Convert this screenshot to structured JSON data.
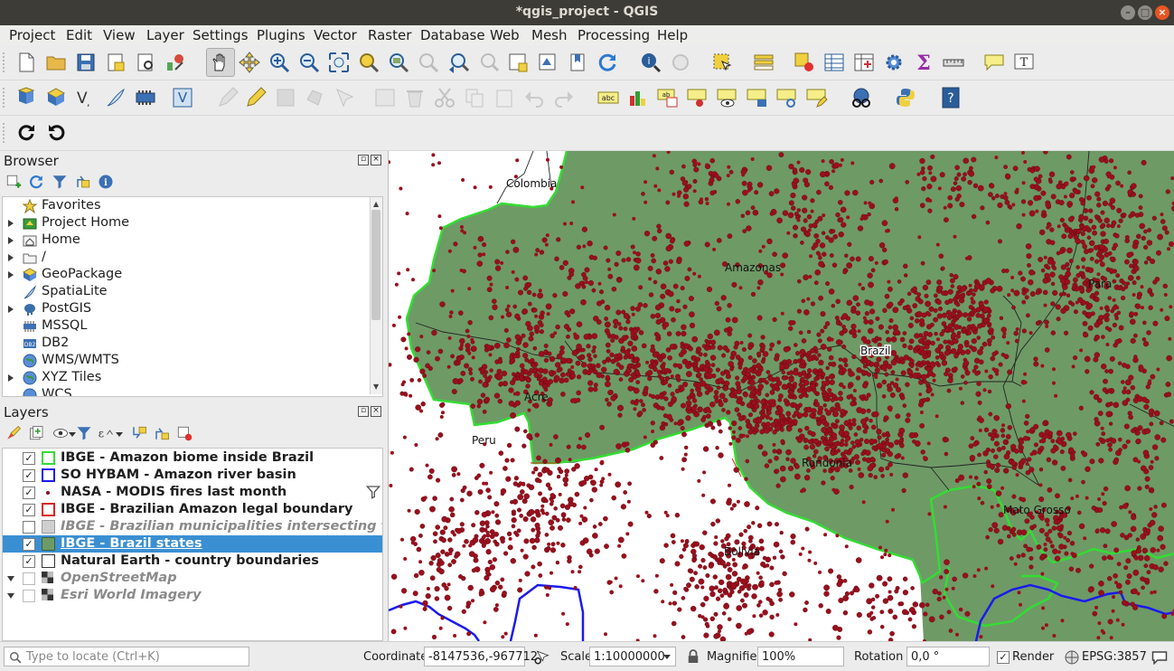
{
  "window": {
    "title": "*qgis_project - QGIS"
  },
  "menu": [
    "Project",
    "Edit",
    "View",
    "Layer",
    "Settings",
    "Plugins",
    "Vector",
    "Raster",
    "Database",
    "Web",
    "Mesh",
    "Processing",
    "Help"
  ],
  "browser": {
    "title": "Browser",
    "items": [
      {
        "label": "Favorites",
        "icon": "star-icon"
      },
      {
        "label": "Project Home",
        "icon": "project-home-icon"
      },
      {
        "label": "Home",
        "icon": "home-folder-icon"
      },
      {
        "label": "/",
        "icon": "folder-icon"
      },
      {
        "label": "GeoPackage",
        "icon": "geopackage-icon"
      },
      {
        "label": "SpatiaLite",
        "icon": "spatialite-icon"
      },
      {
        "label": "PostGIS",
        "icon": "postgis-icon"
      },
      {
        "label": "MSSQL",
        "icon": "mssql-icon"
      },
      {
        "label": "DB2",
        "icon": "db2-icon"
      },
      {
        "label": "WMS/WMTS",
        "icon": "globe-icon"
      },
      {
        "label": "XYZ Tiles",
        "icon": "globe-icon"
      },
      {
        "label": "WCS",
        "icon": "globe-icon"
      }
    ]
  },
  "layers": {
    "title": "Layers",
    "items": [
      {
        "label": "IBGE - Amazon biome inside Brazil",
        "checked": true,
        "symbol": "#33dd33"
      },
      {
        "label": "SO HYBAM - Amazon river basin",
        "checked": true,
        "symbol": "#1a1aee"
      },
      {
        "label": "NASA - MODIS fires last month",
        "checked": true,
        "symbol": "#8b0a1a"
      },
      {
        "label": "IBGE - Brazilian Amazon legal boundary",
        "checked": true,
        "symbol": "#e02020"
      },
      {
        "label": "IBGE - Brazilian municipalities intersecting the a...",
        "checked": false,
        "symbol": "#cfcfcf"
      },
      {
        "label": "IBGE - Brazil states",
        "checked": true,
        "symbol": "#6e9a66"
      },
      {
        "label": "Natural Earth - country boundaries",
        "checked": true,
        "symbol": "#ffffff"
      },
      {
        "label": "OpenStreetMap",
        "checked": false,
        "symbol": "raster"
      },
      {
        "label": "Esri World Imagery",
        "checked": false,
        "symbol": "raster"
      }
    ]
  },
  "map": {
    "labels": [
      "Colombia",
      "Amazonas",
      "Para",
      "Brazil",
      "Acre",
      "Peru",
      "Rondonia",
      "Mato Grosso",
      "Bolivia"
    ],
    "colors": {
      "state_fill": "#6e9a66",
      "fires": "#9a0f1c",
      "biome": "#33dd33",
      "basin": "#1a1aee"
    }
  },
  "status": {
    "locate_placeholder": "Type to locate (Ctrl+K)",
    "coordinate_label": "Coordinate",
    "coordinate_value": "-8147536,-967712",
    "scale_label": "Scale",
    "scale_value": "1:10000000",
    "magnifier_label": "Magnifier",
    "magnifier_value": "100%",
    "rotation_label": "Rotation",
    "rotation_value": "0,0 °",
    "render_label": "Render",
    "crs": "EPSG:3857"
  }
}
